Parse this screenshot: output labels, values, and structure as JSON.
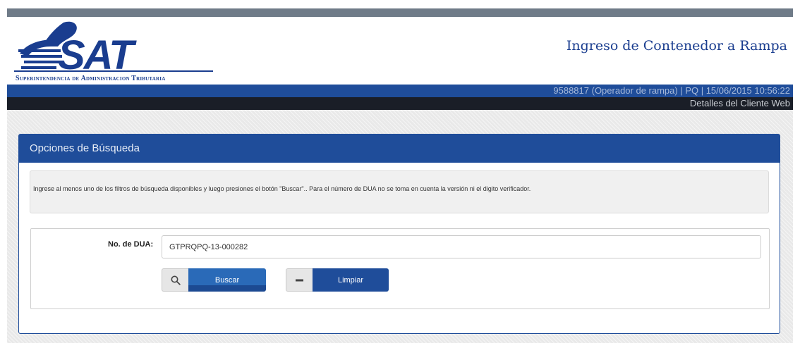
{
  "header": {
    "logo_text": "SAT",
    "logo_subtitle": "Superintendencia de Administracion Tributaria",
    "page_title": "Ingreso de Contenedor a Rampa"
  },
  "user_bar": {
    "info": "9588817 (Operador de rampa) | PQ | 15/06/2015 10:56:22"
  },
  "nav": {
    "client_details_link": "Detalles del Cliente Web"
  },
  "panel": {
    "title": "Opciones de Búsqueda",
    "instructions": "Ingrese al menos uno de los filtros de búsqueda disponibles y luego presiones el botón \"Buscar\".. Para el número de DUA no se toma en cuenta la versión ni el digito verificador.",
    "form": {
      "dua_label": "No. de DUA:",
      "dua_value": "GTPRQPQ-13-000282"
    },
    "buttons": {
      "search_label": "Buscar",
      "search_icon": "search-icon",
      "clear_label": "Limpiar",
      "clear_icon": "minus-icon"
    }
  },
  "colors": {
    "brand_blue": "#1f4d9a",
    "dark_bar": "#1a1e27",
    "top_strip": "#6f7b88"
  }
}
